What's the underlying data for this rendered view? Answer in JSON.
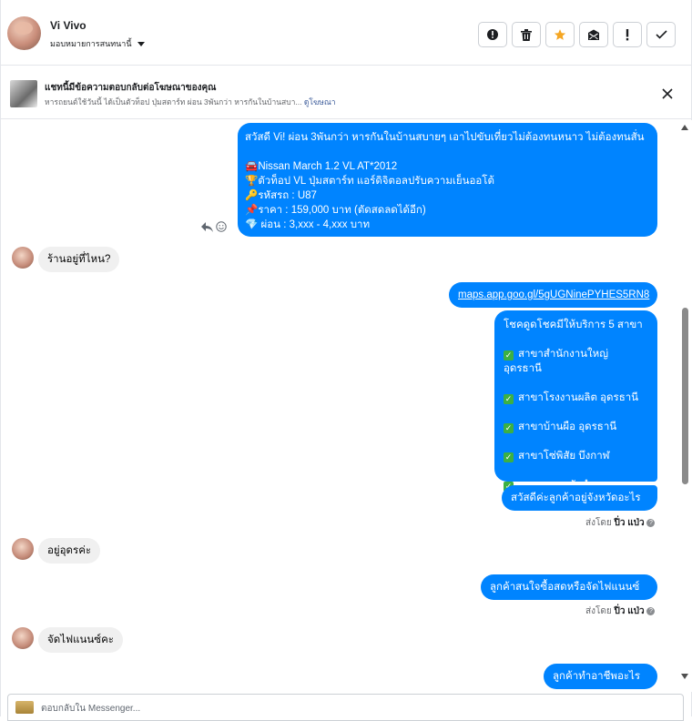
{
  "header": {
    "contact_name": "Vi Vivo",
    "assign_label": "มอบหมายการสนทนานี้",
    "toolbar": [
      {
        "icon": "alert-circle-icon",
        "label": "Mark as spam"
      },
      {
        "icon": "trash-icon",
        "label": "Delete"
      },
      {
        "icon": "star-icon",
        "label": "Star"
      },
      {
        "icon": "mark-unread-icon",
        "label": "Mark unread"
      },
      {
        "icon": "exclamation-icon",
        "label": "Follow up"
      },
      {
        "icon": "checkmark-icon",
        "label": "Done"
      }
    ],
    "star_color": "#f5a623"
  },
  "ad_banner": {
    "title": "แชทนี้มีข้อความตอบกลับต่อโฆษณาของคุณ",
    "subtitle": "หารถยนต์ใช้วันนี้ ได้เป็นตัวท็อป ปุ่มสตาร์ท ผ่อน 3พันกว่า หารกันในบ้านสบา...",
    "link": "ดูโฆษณา"
  },
  "messages": {
    "m1": {
      "line1": "สวัสดี Vi! ผ่อน 3พันกว่า หารกันในบ้านสบายๆ  เอาไปขับเที่ยวไม่ต้องทนหนาว ไม่ต้องทนสั่น",
      "line2": "🚘Nissan March 1.2 VL AT*2012",
      "line3": "🏆ตัวท็อป VL ปุ่มสตาร์ท แอร์ดิจิตอลปรับความเย็นออโต้",
      "line4": "🔑รหัสรถ : U87",
      "line5": "📌ราคา : 159,000 บาท  (ตัดสดลดได้อีก)",
      "line6": "💎 ผ่อน : 3,xxx - 4,xxx บาท"
    },
    "m2": "ร้านอยู่ที่ไหน?",
    "m3": "maps.app.goo.gl/5gUGNinePYHES5RN8",
    "m4": {
      "title": "โชคดูดโชคมีให้บริการ 5 สาขา",
      "branches": [
        "สาขาสำนักงานใหญ่ อุดรธานี",
        "สาขาโรงงานผลิต อุดรธานี",
        "สาขาบ้านผือ อุดรธานี",
        "สาขาโซ่พิสัย บึงกาฬ",
        "สาขาหนองบัวลำภู"
      ]
    },
    "m5": "สวัสดีค่ะลูกค้าอยู่จังหวัดอะไรคะ",
    "sent_by_1": {
      "prefix": "ส่งโดย",
      "name": "ปิ่ว แป่ว"
    },
    "m6": "อยู่อุดรค่ะ",
    "m7": "ลูกค้าสนใจซื้อสดหรือจัดไฟแนนซ์คะ",
    "sent_by_2": {
      "prefix": "ส่งโดย",
      "name": "ปิ่ว แป่ว"
    },
    "m8": "จัดไฟแนนซ์คะ",
    "m9": "ลูกค้าทำอาชีพอะไรคะ"
  },
  "composer": {
    "placeholder": "ตอบกลับใน Messenger..."
  },
  "colors": {
    "outgoing_bubble": "#0084ff",
    "incoming_bubble": "#f0f0f0"
  }
}
